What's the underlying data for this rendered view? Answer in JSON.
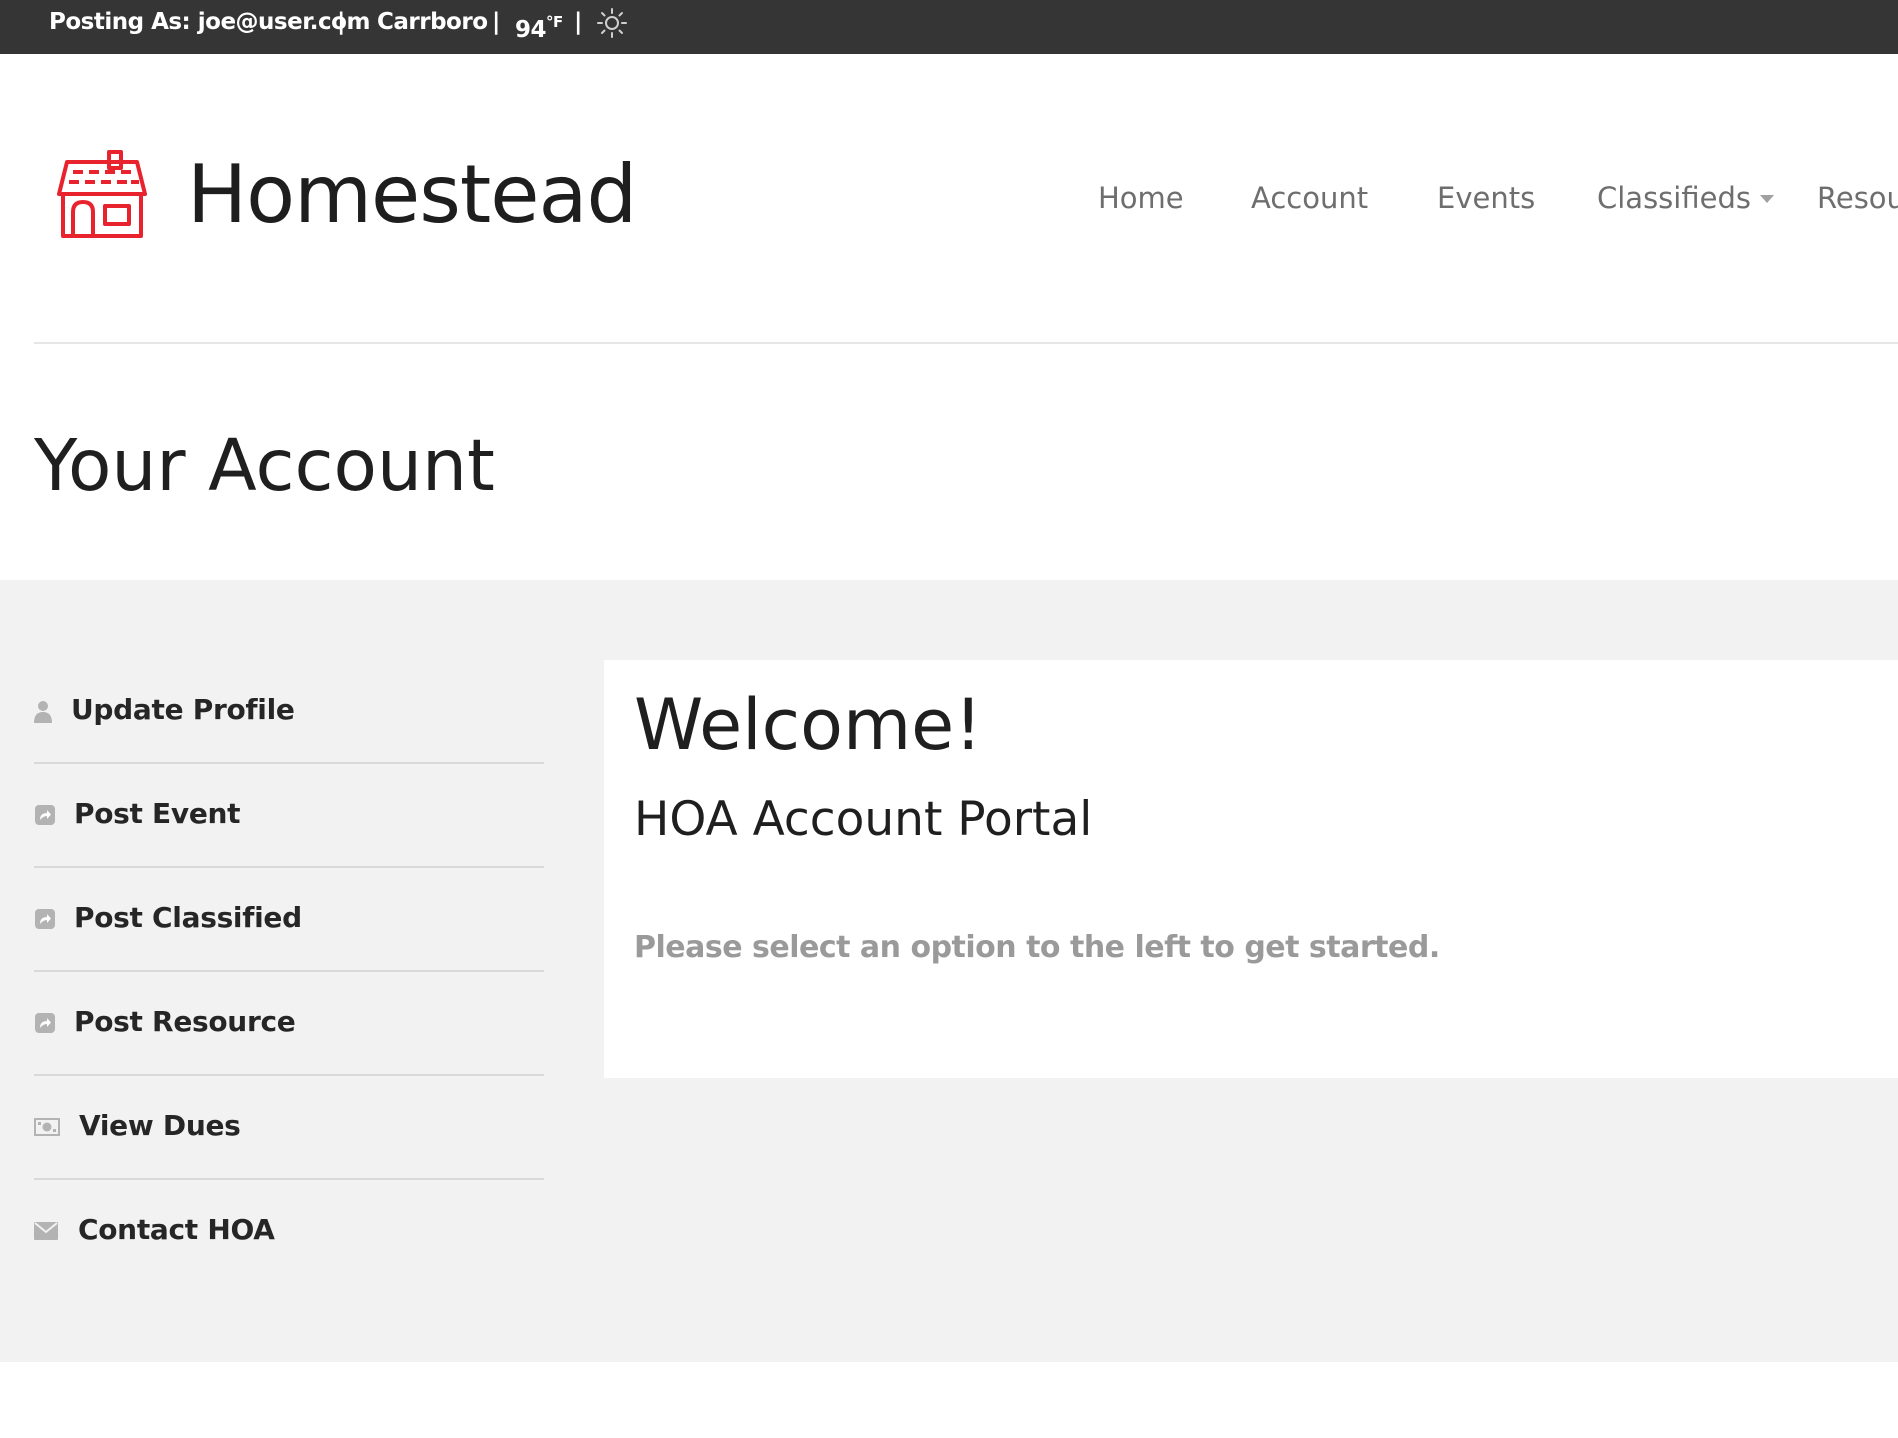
{
  "topbar": {
    "posting_as": "Posting As: joe@user.com",
    "separator": "|",
    "city": "Carrboro",
    "temperature": "94",
    "unit": "°F",
    "weather_icon": "sun-icon"
  },
  "header": {
    "logo_icon": "house-icon",
    "logo_color": "#e8232e",
    "brand": "Homestead",
    "nav": {
      "home": "Home",
      "account": "Account",
      "events": "Events",
      "classifieds": "Classifieds",
      "resources": "Resou"
    }
  },
  "page": {
    "title": "Your Account"
  },
  "sidebar": {
    "items": [
      {
        "label": "Update Profile",
        "icon": "user-icon"
      },
      {
        "label": "Post Event",
        "icon": "share-icon"
      },
      {
        "label": "Post Classified",
        "icon": "share-icon"
      },
      {
        "label": "Post Resource",
        "icon": "share-icon"
      },
      {
        "label": "View Dues",
        "icon": "money-icon"
      },
      {
        "label": "Contact HOA",
        "icon": "envelope-icon"
      }
    ]
  },
  "main": {
    "title": "Welcome!",
    "subtitle": "HOA Account Portal",
    "hint": "Please select an option to the left to get started."
  }
}
